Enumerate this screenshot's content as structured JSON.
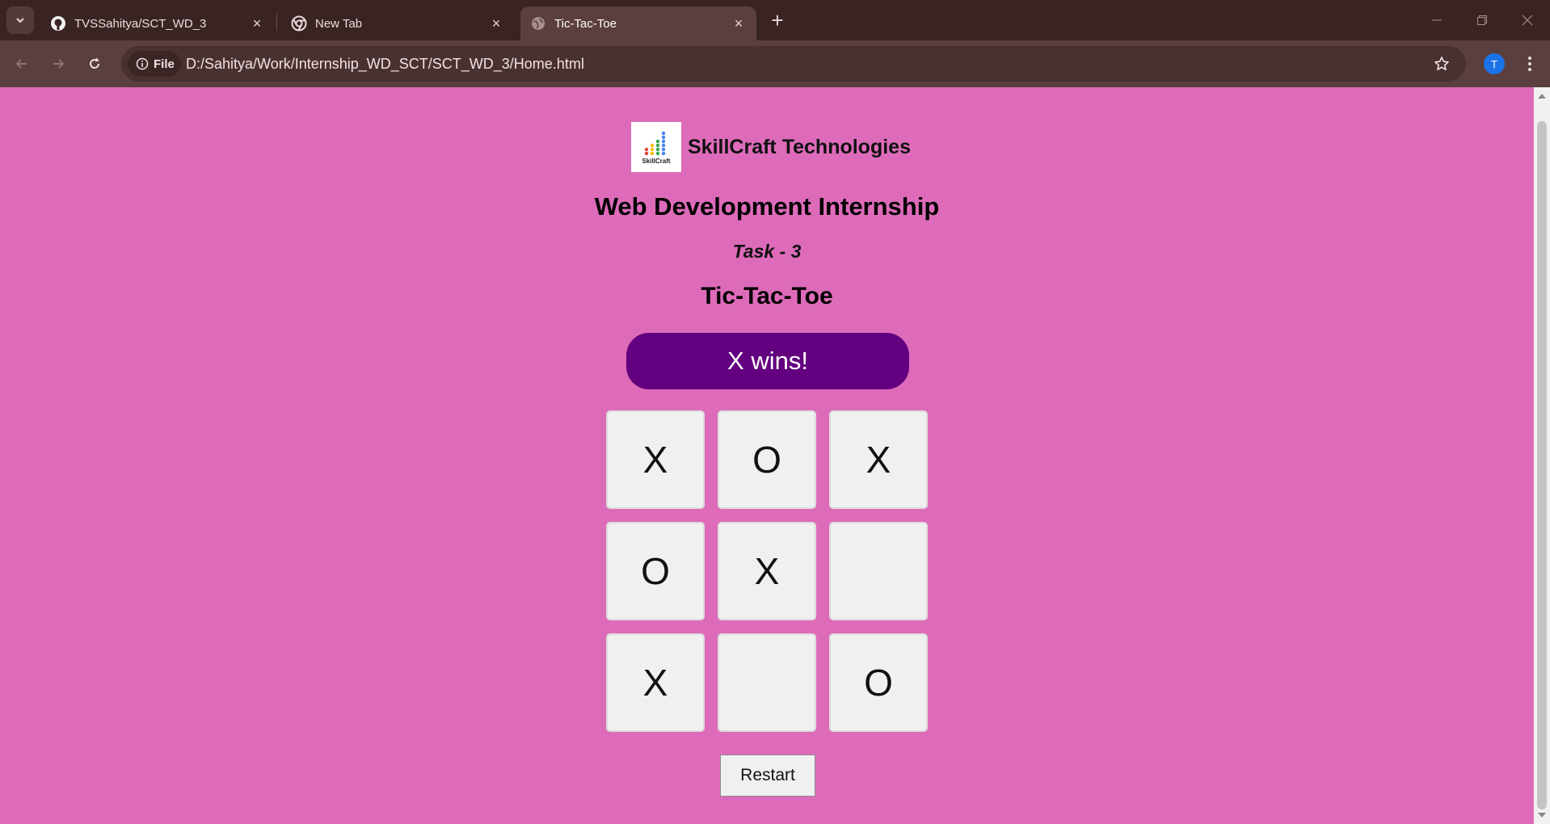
{
  "browser": {
    "tabs": [
      {
        "title": "TVSSahitya/SCT_WD_3",
        "icon": "github-icon",
        "active": false
      },
      {
        "title": "New Tab",
        "icon": "chrome-icon",
        "active": false
      },
      {
        "title": "Tic-Tac-Toe",
        "icon": "globe-icon",
        "active": true
      }
    ],
    "new_tab_label": "+",
    "chip_label": "File",
    "url": "D:/Sahitya/Work/Internship_WD_SCT/SCT_WD_3/Home.html",
    "profile_initial": "T",
    "close_glyph": "×"
  },
  "page": {
    "logo_text": "SkillCraft",
    "brand_name": "SkillCraft Technologies",
    "heading": "Web Development Internship",
    "task": "Task - 3",
    "game_title": "Tic-Tac-Toe",
    "status": "X wins!",
    "board": [
      "X",
      "O",
      "X",
      "O",
      "X",
      "",
      "X",
      "",
      "O"
    ],
    "restart_label": "Restart"
  },
  "colors": {
    "page_background": "#de6bba",
    "status_background": "#63007f",
    "cell_background": "#f0f0f0",
    "tab_strip": "#3a2323",
    "toolbar": "#5b3e3e"
  }
}
